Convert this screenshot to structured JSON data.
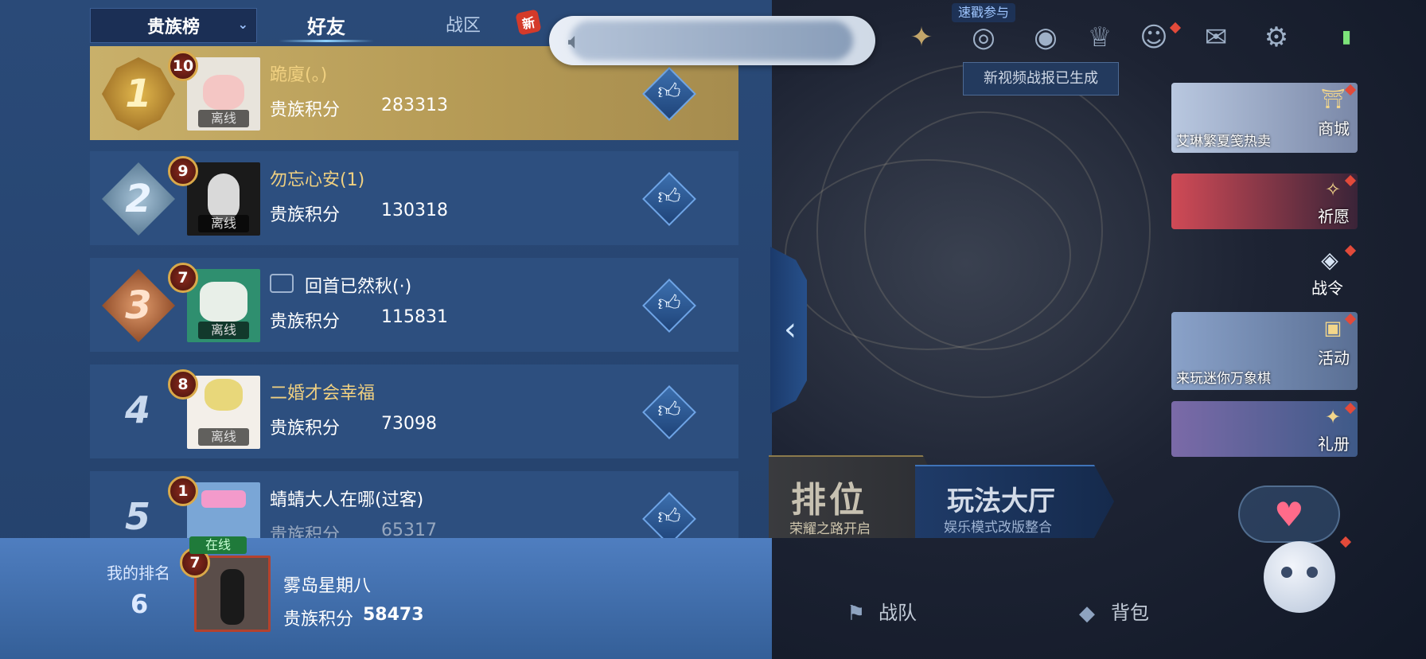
{
  "tabs": {
    "dropdown": "贵族榜",
    "friends": "好友",
    "zone": "战区",
    "zone_badge": "新"
  },
  "rows": [
    {
      "rank": "1",
      "level": "10",
      "name": "跪廈(。)",
      "status": "离线",
      "score_label": "贵族积分",
      "score": "283313"
    },
    {
      "rank": "2",
      "level": "9",
      "name": "勿忘心安(1)",
      "status": "离线",
      "score_label": "贵族积分",
      "score": "130318"
    },
    {
      "rank": "3",
      "level": "7",
      "name": "回首已然秋(·)",
      "status": "离线",
      "score_label": "贵族积分",
      "score": "115831"
    },
    {
      "rank": "4",
      "level": "8",
      "name": "二婚才会幸福",
      "status": "离线",
      "score_label": "贵族积分",
      "score": "73098"
    },
    {
      "rank": "5",
      "level": "1",
      "name": "蜻蜻大人在哪(过客)",
      "status": "在线",
      "score_label": "贵族积分",
      "score": "65317"
    }
  ],
  "my_rank": {
    "label": "我的排名",
    "rank": "6",
    "level": "7",
    "name": "雾岛星期八",
    "score_label": "贵族积分",
    "score": "58473"
  },
  "top": {
    "live_badge": "速戳参与",
    "tooltip": "新视频战报已生成"
  },
  "cards": {
    "shop_caption": "艾琳繁夏笺热卖",
    "shop_label": "商城",
    "wish_label": "祈愿",
    "pass_label": "战令",
    "activity_caption": "来玩迷你万象棋",
    "activity_label": "活动",
    "gift_label": "礼册"
  },
  "modes": {
    "ranked_title": "排位",
    "ranked_sub": "荣耀之路开启",
    "hall_title": "玩法大厅",
    "hall_sub": "娱乐模式改版整合"
  },
  "bottom_nav": {
    "team": "战队",
    "bag": "背包"
  },
  "colors": {
    "panel_bg": "#2a4a78",
    "row_bg": "#2d4f7f",
    "first_row_gold": "#c9b06a",
    "name_gold": "#f0d080",
    "new_badge": "#d43a2a"
  }
}
